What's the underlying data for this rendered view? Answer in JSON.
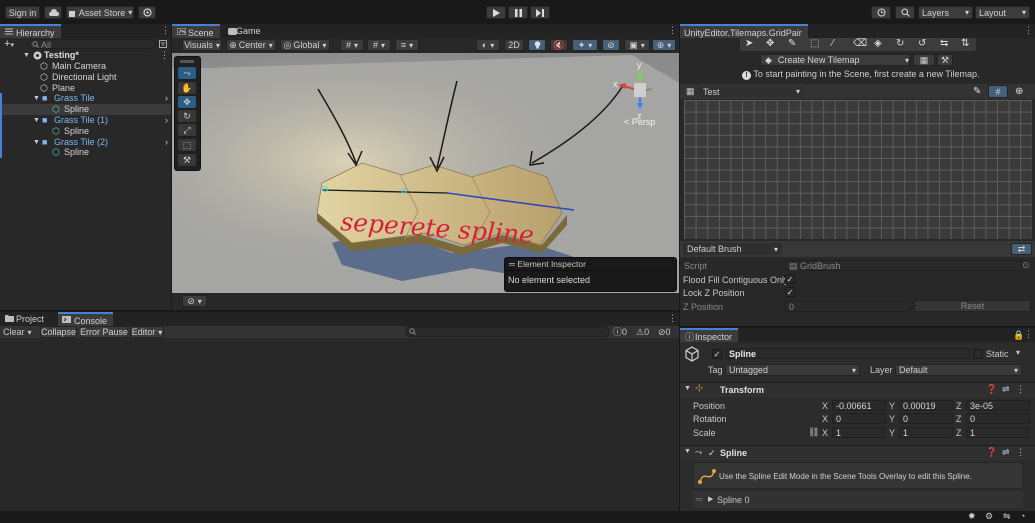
{
  "toolbar": {
    "sign_in": "Sign in",
    "asset_store": "Asset Store",
    "layers": "Layers",
    "layout": "Layout"
  },
  "hierarchy": {
    "tab": "Hierarchy",
    "search_placeholder": "All",
    "scene": "Testing*",
    "items": [
      {
        "label": "Main Camera",
        "type": "object",
        "indent": 2,
        "selected": false
      },
      {
        "label": "Directional Light",
        "type": "object",
        "indent": 2,
        "selected": false
      },
      {
        "label": "Plane",
        "type": "object",
        "indent": 2,
        "selected": false
      },
      {
        "label": "Grass Tile",
        "type": "prefab",
        "indent": 2,
        "selected": false
      },
      {
        "label": "Spline",
        "type": "spline",
        "indent": 3,
        "selected": true
      },
      {
        "label": "Grass Tile (1)",
        "type": "prefab",
        "indent": 2,
        "selected": false
      },
      {
        "label": "Spline",
        "type": "spline",
        "indent": 3,
        "selected": false
      },
      {
        "label": "Grass Tile (2)",
        "type": "prefab",
        "indent": 2,
        "selected": false
      },
      {
        "label": "Spline",
        "type": "spline",
        "indent": 3,
        "selected": false
      }
    ]
  },
  "scene": {
    "tab_scene": "Scene",
    "tab_game": "Game",
    "visuals": "Visuals",
    "center": "Center",
    "global": "Global",
    "mode_2d": "2D",
    "persp": "< Persp",
    "gizmo_y": "y",
    "gizmo_x": "x",
    "gizmo_z": "z",
    "handwritten": "seperete spline",
    "element_inspector_title": "Element Inspector",
    "element_inspector_text": "No element selected"
  },
  "bottom": {
    "tab_project": "Project",
    "tab_console": "Console",
    "clear": "Clear",
    "collapse": "Collapse",
    "error_pause": "Error Pause",
    "editor": "Editor",
    "count_info": "0",
    "count_warn": "0",
    "count_error": "0"
  },
  "tile_palette": {
    "title": "UnityEditor.Tilemaps.GridPair",
    "create_new": "Create New Tilemap",
    "hint": "To start painting in the Scene, first create a new Tilemap.",
    "palette": "Test",
    "brush": "Default Brush",
    "script_label": "Script",
    "script_value": "GridBrush",
    "flood_fill": "Flood Fill Contiguous Only",
    "lock_z": "Lock Z Position",
    "z_position_label": "Z Position",
    "z_position_value": "0",
    "reset": "Reset"
  },
  "inspector": {
    "tab": "Inspector",
    "object_name": "Spline",
    "static": "Static",
    "tag_label": "Tag",
    "tag_value": "Untagged",
    "layer_label": "Layer",
    "layer_value": "Default",
    "transform_title": "Transform",
    "position_label": "Position",
    "rotation_label": "Rotation",
    "scale_label": "Scale",
    "position": {
      "x": "-0.00661",
      "y": "0.00019",
      "z": "3e-05"
    },
    "rotation": {
      "x": "0",
      "y": "0",
      "z": "0"
    },
    "scale": {
      "x": "1",
      "y": "1",
      "z": "1"
    },
    "spline_title": "Spline",
    "spline_help": "Use the Spline Edit Mode in the Scene Tools Overlay to edit this Spline.",
    "spline_item": "Spline 0"
  },
  "colors": {
    "accent": "#4a7fd8",
    "selection": "#2c5d87",
    "prefab": "#7cb8f0",
    "spline": "#5ad0c0"
  }
}
